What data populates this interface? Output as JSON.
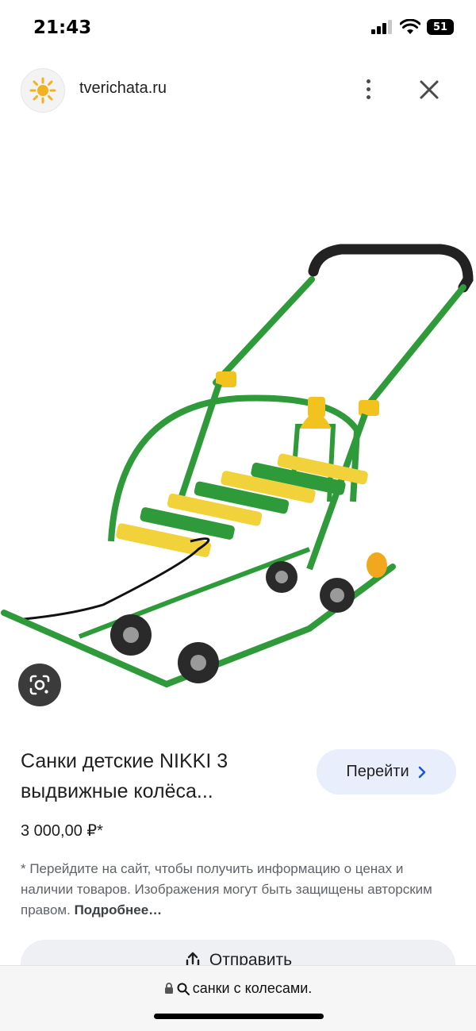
{
  "status_bar": {
    "time": "21:43",
    "battery": "51"
  },
  "header": {
    "domain": "tverichata.ru"
  },
  "product": {
    "title": "Санки детские NIKKI 3 выдвижные колёса...",
    "price": "3 000,00 ₽*",
    "go_button_label": "Перейти"
  },
  "disclaimer": {
    "text": "* Перейдите на сайт, чтобы получить информацию о ценах и наличии товаров. Изображения могут быть защищены авторским правом.",
    "more_link": "Подробнее…"
  },
  "share_button_label": "Отправить",
  "address_bar": {
    "query": "санки с колесами."
  },
  "colors": {
    "frame_green": "#2f9a3a",
    "slat_yellow": "#f2d23a",
    "button_blue_bg": "#e8eefc"
  },
  "icons": [
    "signal-icon",
    "wifi-icon",
    "battery-icon",
    "sun-logo-icon",
    "more-vert-icon",
    "close-icon",
    "google-lens-icon",
    "chevron-right-icon",
    "share-icon",
    "lock-icon",
    "search-icon"
  ]
}
